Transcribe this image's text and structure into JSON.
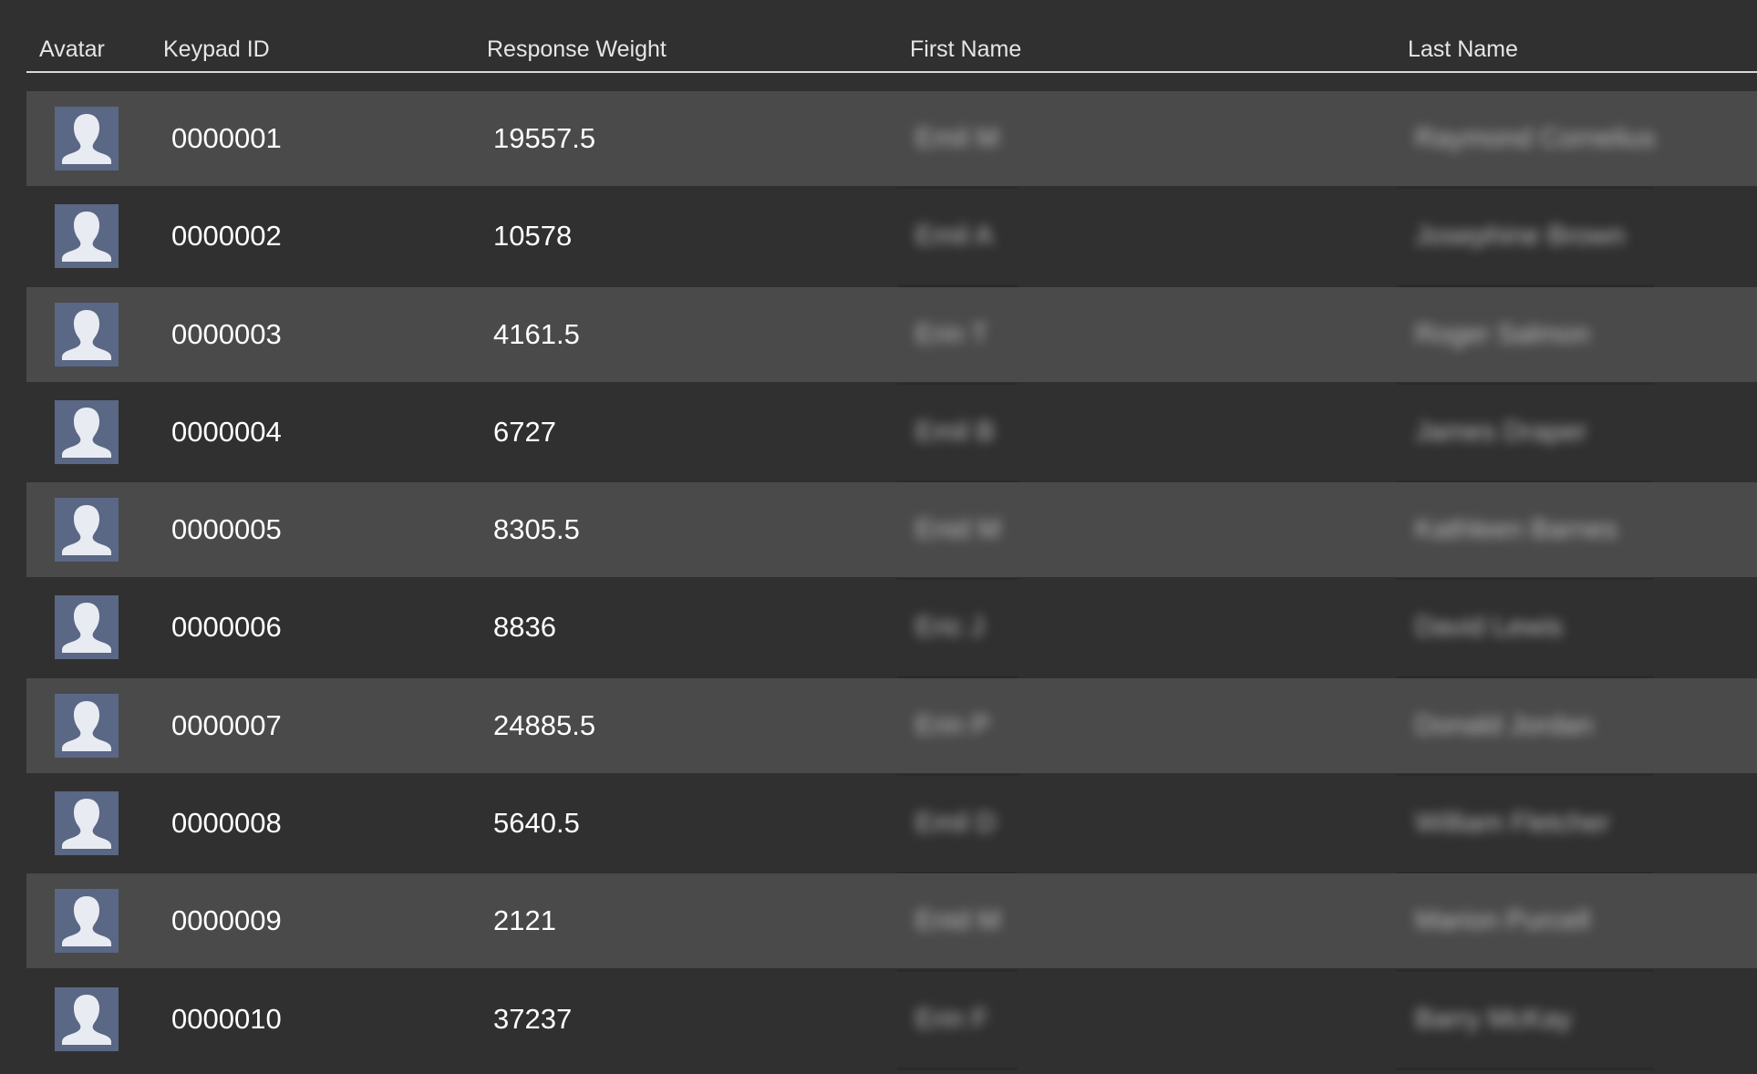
{
  "columns": {
    "avatar": "Avatar",
    "keypad_id": "Keypad ID",
    "response_weight": "Response Weight",
    "first_name": "First Name",
    "last_name": "Last Name"
  },
  "icons": {
    "avatar": "person-silhouette-icon"
  },
  "colors": {
    "background": "#303030",
    "row_alt": "#4a4a4a",
    "avatar_bg": "#5a6785",
    "avatar_fg": "#e8ecf2"
  },
  "rows": [
    {
      "keypad_id": "0000001",
      "response_weight": "19557.5",
      "first_name": "Emil M",
      "last_name": "Raymond Cornelius"
    },
    {
      "keypad_id": "0000002",
      "response_weight": "10578",
      "first_name": "Emil A",
      "last_name": "Josephine Brown"
    },
    {
      "keypad_id": "0000003",
      "response_weight": "4161.5",
      "first_name": "Erin T",
      "last_name": "Roger Salmon"
    },
    {
      "keypad_id": "0000004",
      "response_weight": "6727",
      "first_name": "Emil B",
      "last_name": "James Draper"
    },
    {
      "keypad_id": "0000005",
      "response_weight": "8305.5",
      "first_name": "Enid M",
      "last_name": "Kathleen Barnes"
    },
    {
      "keypad_id": "0000006",
      "response_weight": "8836",
      "first_name": "Eric J",
      "last_name": "David Lewis"
    },
    {
      "keypad_id": "0000007",
      "response_weight": "24885.5",
      "first_name": "Erin P",
      "last_name": "Donald Jordan"
    },
    {
      "keypad_id": "0000008",
      "response_weight": "5640.5",
      "first_name": "Emil D",
      "last_name": "William Fletcher"
    },
    {
      "keypad_id": "0000009",
      "response_weight": "2121",
      "first_name": "Enid M",
      "last_name": "Marion Purcell"
    },
    {
      "keypad_id": "0000010",
      "response_weight": "37237",
      "first_name": "Erin F",
      "last_name": "Barry McKay"
    }
  ]
}
